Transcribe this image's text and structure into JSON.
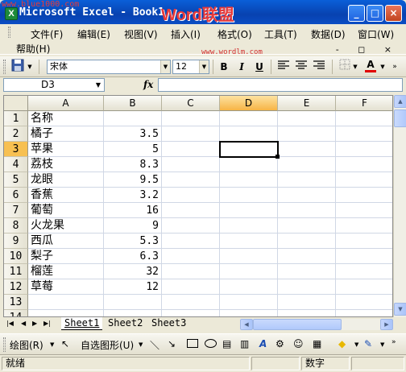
{
  "window": {
    "watermark": "www.blue1000.com",
    "title": "Microsoft Excel - Book1",
    "brand": "Word联盟",
    "brand_url": "www.wordlm.com",
    "controls": {
      "minimize": "_",
      "maximize": "□",
      "close": "×"
    }
  },
  "menu": {
    "items": [
      {
        "label": "文件(F)"
      },
      {
        "label": "编辑(E)"
      },
      {
        "label": "视图(V)"
      },
      {
        "label": "插入(I)"
      },
      {
        "label": "格式(O)"
      },
      {
        "label": "工具(T)"
      },
      {
        "label": "数据(D)"
      },
      {
        "label": "窗口(W)"
      }
    ],
    "help": "帮助(H)",
    "mdi_controls": "- ◻ ×"
  },
  "toolbar": {
    "font_name": "宋体",
    "font_size": "12",
    "bold": "B",
    "italic": "I",
    "underline": "U",
    "font_color_letter": "A",
    "accent_color": "#e00000"
  },
  "formula_bar": {
    "name_box": "D3",
    "fx": "fx",
    "formula": ""
  },
  "grid": {
    "columns": [
      "A",
      "B",
      "C",
      "D",
      "E",
      "F"
    ],
    "active_column": "D",
    "active_row": "3",
    "rows": [
      {
        "n": "1",
        "a": "名称",
        "b": ""
      },
      {
        "n": "2",
        "a": "橘子",
        "b": "3.5"
      },
      {
        "n": "3",
        "a": "苹果",
        "b": "5"
      },
      {
        "n": "4",
        "a": "荔枝",
        "b": "8.3"
      },
      {
        "n": "5",
        "a": "龙眼",
        "b": "9.5"
      },
      {
        "n": "6",
        "a": "香蕉",
        "b": "3.2"
      },
      {
        "n": "7",
        "a": "葡萄",
        "b": "16"
      },
      {
        "n": "8",
        "a": "火龙果",
        "b": "9"
      },
      {
        "n": "9",
        "a": "西瓜",
        "b": "5.3"
      },
      {
        "n": "10",
        "a": "梨子",
        "b": "6.3"
      },
      {
        "n": "11",
        "a": "榴莲",
        "b": "32"
      },
      {
        "n": "12",
        "a": "草莓",
        "b": "12"
      },
      {
        "n": "13",
        "a": "",
        "b": ""
      },
      {
        "n": "14",
        "a": "",
        "b": ""
      }
    ]
  },
  "sheets": {
    "tabs": [
      "Sheet1",
      "Sheet2",
      "Sheet3"
    ],
    "active": "Sheet1"
  },
  "drawing_toolbar": {
    "draw": "绘图(R)",
    "autoshapes": "自选图形(U)"
  },
  "status": {
    "ready": "就绪",
    "mode": "数字"
  }
}
